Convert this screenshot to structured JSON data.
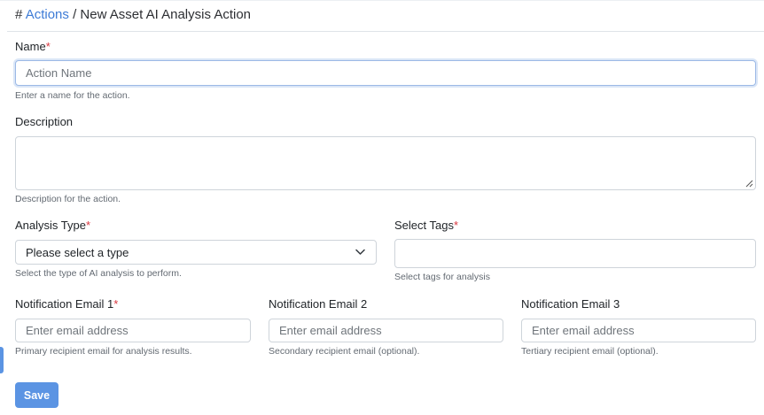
{
  "breadcrumb": {
    "hash": "#",
    "link": "Actions",
    "separator": "/",
    "current": "New Asset AI Analysis Action"
  },
  "form": {
    "name": {
      "label": "Name",
      "required_mark": "*",
      "placeholder": "Action Name",
      "value": "",
      "help": "Enter a name for the action."
    },
    "description": {
      "label": "Description",
      "value": "",
      "help": "Description for the action."
    },
    "analysis_type": {
      "label": "Analysis Type",
      "required_mark": "*",
      "selected": "Please select a type",
      "help": "Select the type of AI analysis to perform."
    },
    "tags": {
      "label": "Select Tags",
      "required_mark": "*",
      "value": "",
      "help": "Select tags for analysis"
    },
    "email1": {
      "label": "Notification Email 1",
      "required_mark": "*",
      "placeholder": "Enter email address",
      "help": "Primary recipient email for analysis results."
    },
    "email2": {
      "label": "Notification Email 2",
      "placeholder": "Enter email address",
      "help": "Secondary recipient email (optional)."
    },
    "email3": {
      "label": "Notification Email 3",
      "placeholder": "Enter email address",
      "help": "Tertiary recipient email (optional)."
    },
    "save_label": "Save"
  },
  "icons": {
    "select_chevron": "chevron-down-icon",
    "textarea_grip": "resize-grip-icon"
  },
  "colors": {
    "link": "#3d7bd6",
    "required": "#d9363e",
    "primary_button": "#5b94e3"
  }
}
